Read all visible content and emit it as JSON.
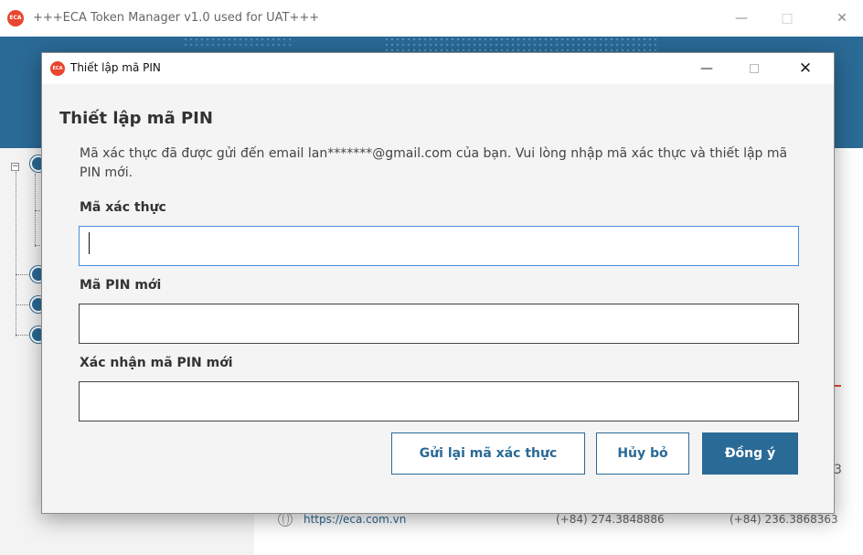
{
  "main_window": {
    "logo_text": "ECA",
    "title": "+++ECA Token Manager v1.0 used for UAT+++",
    "controls": {
      "minimize": "—",
      "maximize": "□",
      "close": "✕"
    },
    "footer": {
      "website": "https://eca.com.vn",
      "phone_1": "(+84) 274.3848886",
      "phone_2": "(+84) 236.3868363",
      "peek_digit": "3"
    },
    "icons": [
      "globe-icon",
      "tree-node-icon"
    ]
  },
  "dialog": {
    "logo_text": "ECA",
    "window_title": "Thiết lập mã PIN",
    "controls": {
      "minimize": "—",
      "close": "✕"
    },
    "heading": "Thiết lập mã PIN",
    "description": "Mã xác thực đã được gửi đến email lan*******@gmail.com của bạn. Vui lòng nhập mã xác thực và thiết lập mã PIN mới.",
    "fields": {
      "verification_code": {
        "label": "Mã xác thực",
        "value": ""
      },
      "new_pin": {
        "label": "Mã PIN mới",
        "value": ""
      },
      "confirm_pin": {
        "label": "Xác nhận mã PIN mới",
        "value": ""
      }
    },
    "buttons": {
      "resend": "Gửi lại mã xác thực",
      "cancel": "Hủy bỏ",
      "ok": "Đồng ý"
    }
  },
  "colors": {
    "brand_blue": "#2a6a96",
    "brand_red": "#e8462f",
    "focus_border": "#4a8fd8"
  }
}
